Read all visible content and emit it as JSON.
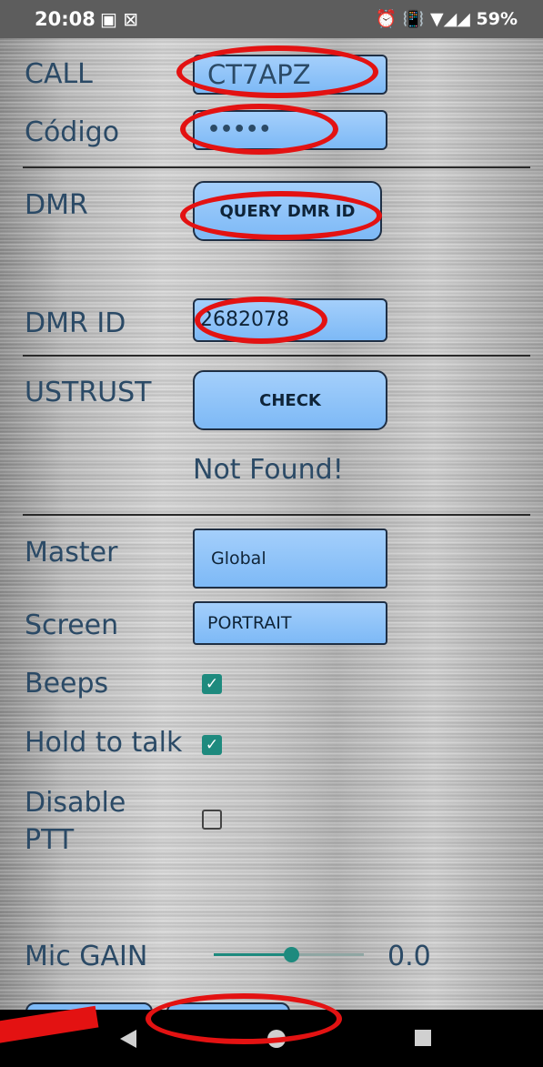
{
  "status": {
    "time": "20:08",
    "left_icons": "▣ ⊠",
    "right_icons": "⏰ 📳 ▼◢◢ 59%"
  },
  "form": {
    "call_label": "CALL",
    "call_value": "CT7APZ",
    "codigo_label": "Código",
    "codigo_value": "•••••",
    "dmr_label": "DMR",
    "query_button": "QUERY DMR ID",
    "dmrid_label": "DMR ID",
    "dmrid_value": "2682078",
    "ustrust_label": "USTRUST",
    "check_button": "CHECK",
    "ustrust_result": "Not Found!",
    "master_label": "Master",
    "master_value": "Global",
    "screen_label": "Screen",
    "screen_value": "PORTRAIT",
    "beeps_label": "Beeps",
    "hold_label": "Hold to talk",
    "disable_label_1": "Disable",
    "disable_label_2": "PTT",
    "mic_label": "Mic GAIN",
    "mic_value": "0.0"
  },
  "checkboxes": {
    "beeps": true,
    "hold_to_talk": true,
    "disable_ptt": false
  },
  "colors": {
    "label": "#2b4a66",
    "field": "#7db9f6",
    "accent": "#1e8a7e",
    "annotation": "#e31212"
  }
}
